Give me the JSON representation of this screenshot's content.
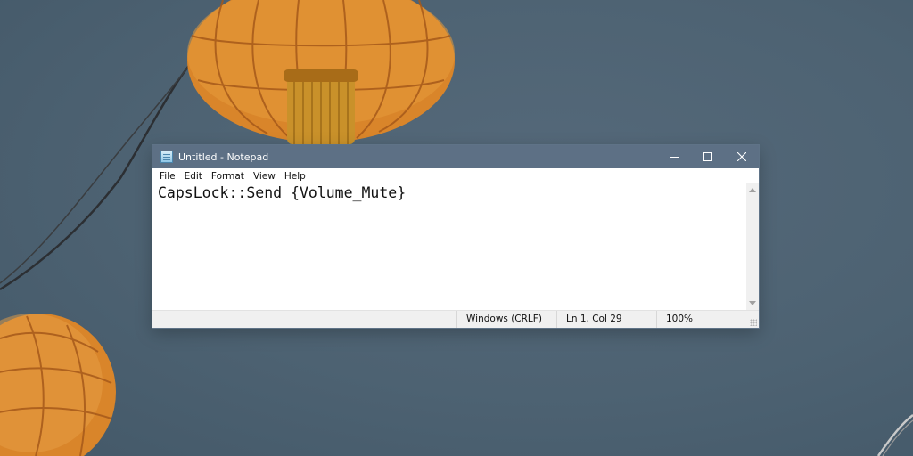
{
  "window": {
    "title": "Untitled - Notepad",
    "controls": {
      "minimize": "minimize",
      "maximize": "maximize",
      "close": "close"
    }
  },
  "menu": {
    "items": [
      "File",
      "Edit",
      "Format",
      "View",
      "Help"
    ]
  },
  "editor": {
    "content": "CapsLock::Send {Volume_Mute}"
  },
  "status": {
    "encoding": "Windows (CRLF)",
    "position": "Ln 1, Col 29",
    "zoom": "100%"
  },
  "colors": {
    "titlebar": "#5d7085",
    "desktop": "#4d6272",
    "lantern": "#d9852a"
  },
  "icons": [
    "notepad-app-icon",
    "minimize-icon",
    "maximize-icon",
    "close-icon",
    "scroll-up-icon",
    "scroll-down-icon",
    "resize-grip-icon"
  ]
}
